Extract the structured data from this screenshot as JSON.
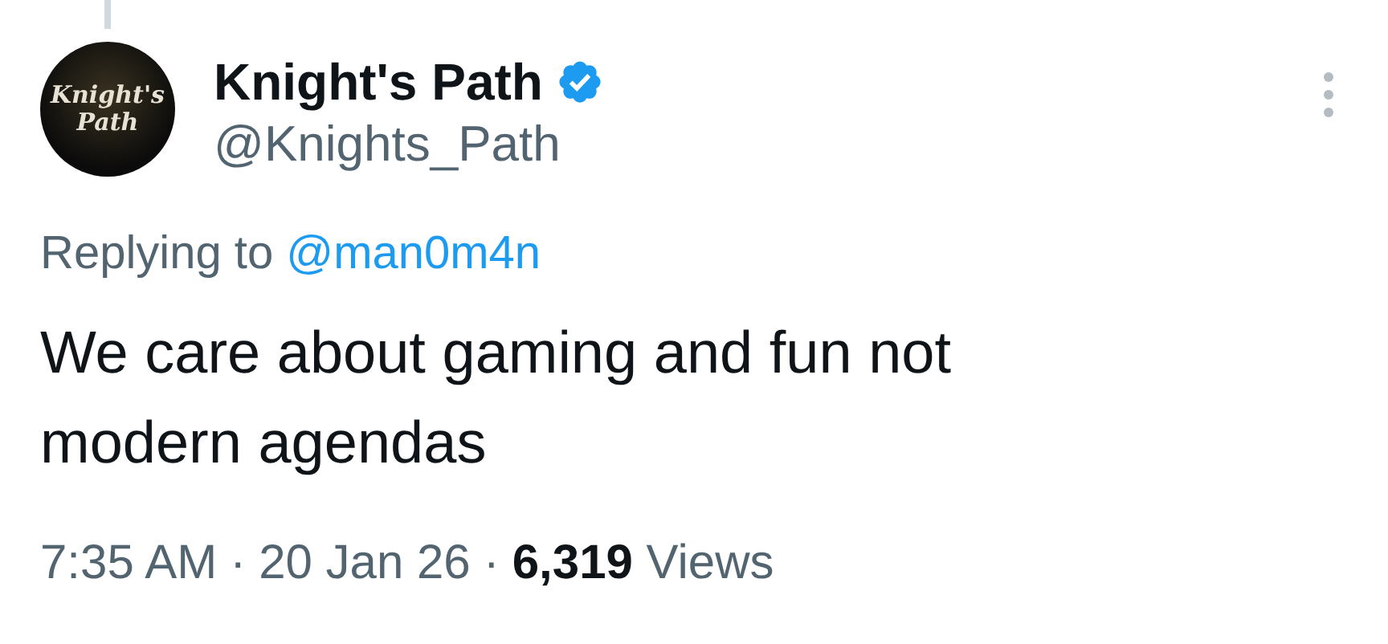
{
  "author": {
    "avatar_logo": [
      "Knight's",
      "Path"
    ],
    "name": "Knight's Path",
    "verified": true,
    "handle": "@Knights_Path"
  },
  "reply": {
    "prefix": "Replying to",
    "mention": "@man0m4n"
  },
  "text": "We care about gaming and fun not modern agendas",
  "meta": {
    "time": "7:35 AM",
    "separator_1": "·",
    "date": "20 Jan 26",
    "separator_2": "·",
    "views_count": "6,319",
    "views_label": "Views"
  }
}
